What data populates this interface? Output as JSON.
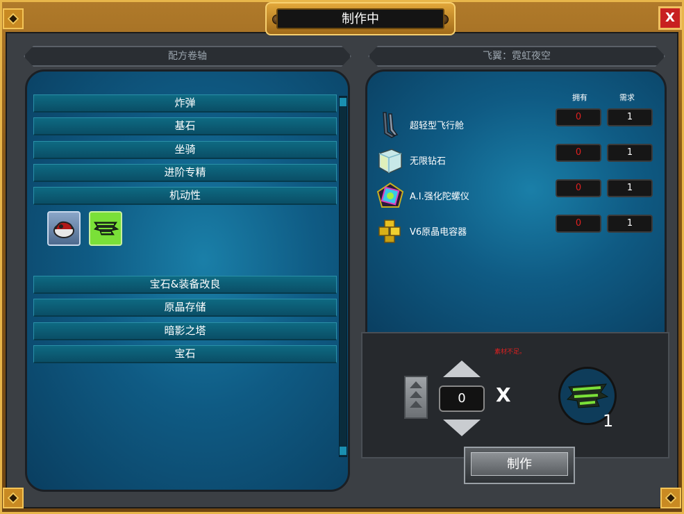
{
  "window": {
    "title": "制作中",
    "close_label": "X"
  },
  "left_panel": {
    "header": "配方卷轴",
    "categories": [
      "炸弹",
      "基石",
      "坐骑",
      "进阶专精",
      "机动性",
      "宝石&装备改良",
      "原晶存储",
      "暗影之塔",
      "宝石"
    ],
    "expanded_items": [
      {
        "icon": "boots-icon"
      },
      {
        "icon": "wings-icon"
      }
    ]
  },
  "right_panel": {
    "header": "飞翼：霓虹夜空",
    "columns": {
      "have": "拥有",
      "need": "需求"
    },
    "materials": [
      {
        "name": "超轻型飞行舱",
        "have": "0",
        "need": "1",
        "icon": "flight-pod-icon"
      },
      {
        "name": "无限钻石",
        "have": "0",
        "need": "1",
        "icon": "diamond-cube-icon"
      },
      {
        "name": "A.I.强化陀螺仪",
        "have": "0",
        "need": "1",
        "icon": "gyroscope-icon"
      },
      {
        "name": "V6原晶电容器",
        "have": "0",
        "need": "1",
        "icon": "capacitor-icon"
      }
    ]
  },
  "craft": {
    "warning": "素材不足。",
    "quantity": "0",
    "multiply": "X",
    "result_count": "1",
    "button_label": "制作"
  },
  "colors": {
    "frame_gold": "#e8b64a",
    "panel_blue": "#0f5b84",
    "insufficient_red": "#e02020",
    "close_red": "#c82020"
  }
}
